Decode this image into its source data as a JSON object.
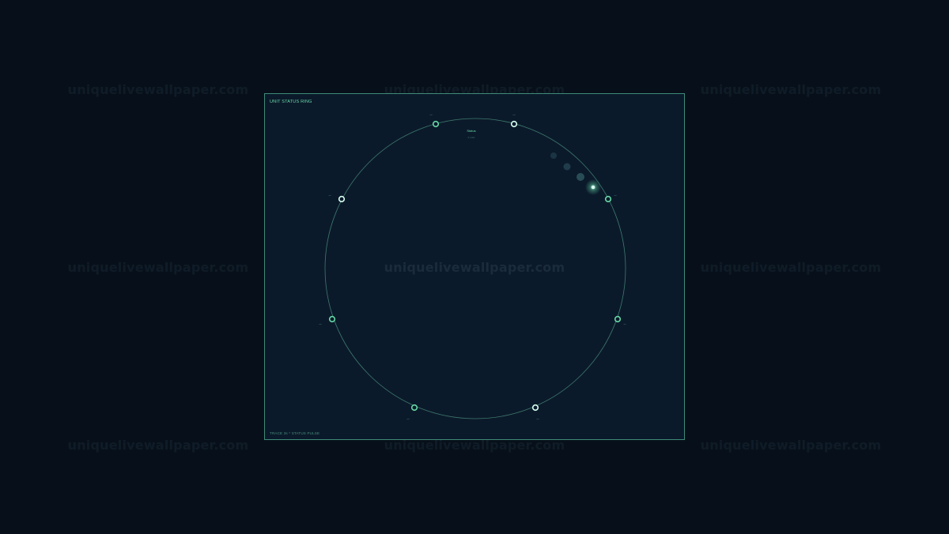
{
  "watermark": {
    "text": "uniquelivewallpaper.com"
  },
  "panel": {
    "title": "UNIT STATUS RING",
    "footer": "TRACE 3s * STATUS PULSE",
    "center_label": "Status",
    "center_sublabel": "0 units"
  },
  "nodes": [
    {
      "label": "unit"
    },
    {
      "label": "unit"
    },
    {
      "label": "unit"
    },
    {
      "label": "unit"
    },
    {
      "label": "unit"
    },
    {
      "label": "unit"
    },
    {
      "label": "unit"
    },
    {
      "label": "unit"
    }
  ],
  "colors": {
    "accent": "#67d9a6",
    "ring": "#3e7a6c",
    "node_fill": "#0b1a2b",
    "panel_bg": "#0b1a2b",
    "page_bg": "#07101a"
  }
}
